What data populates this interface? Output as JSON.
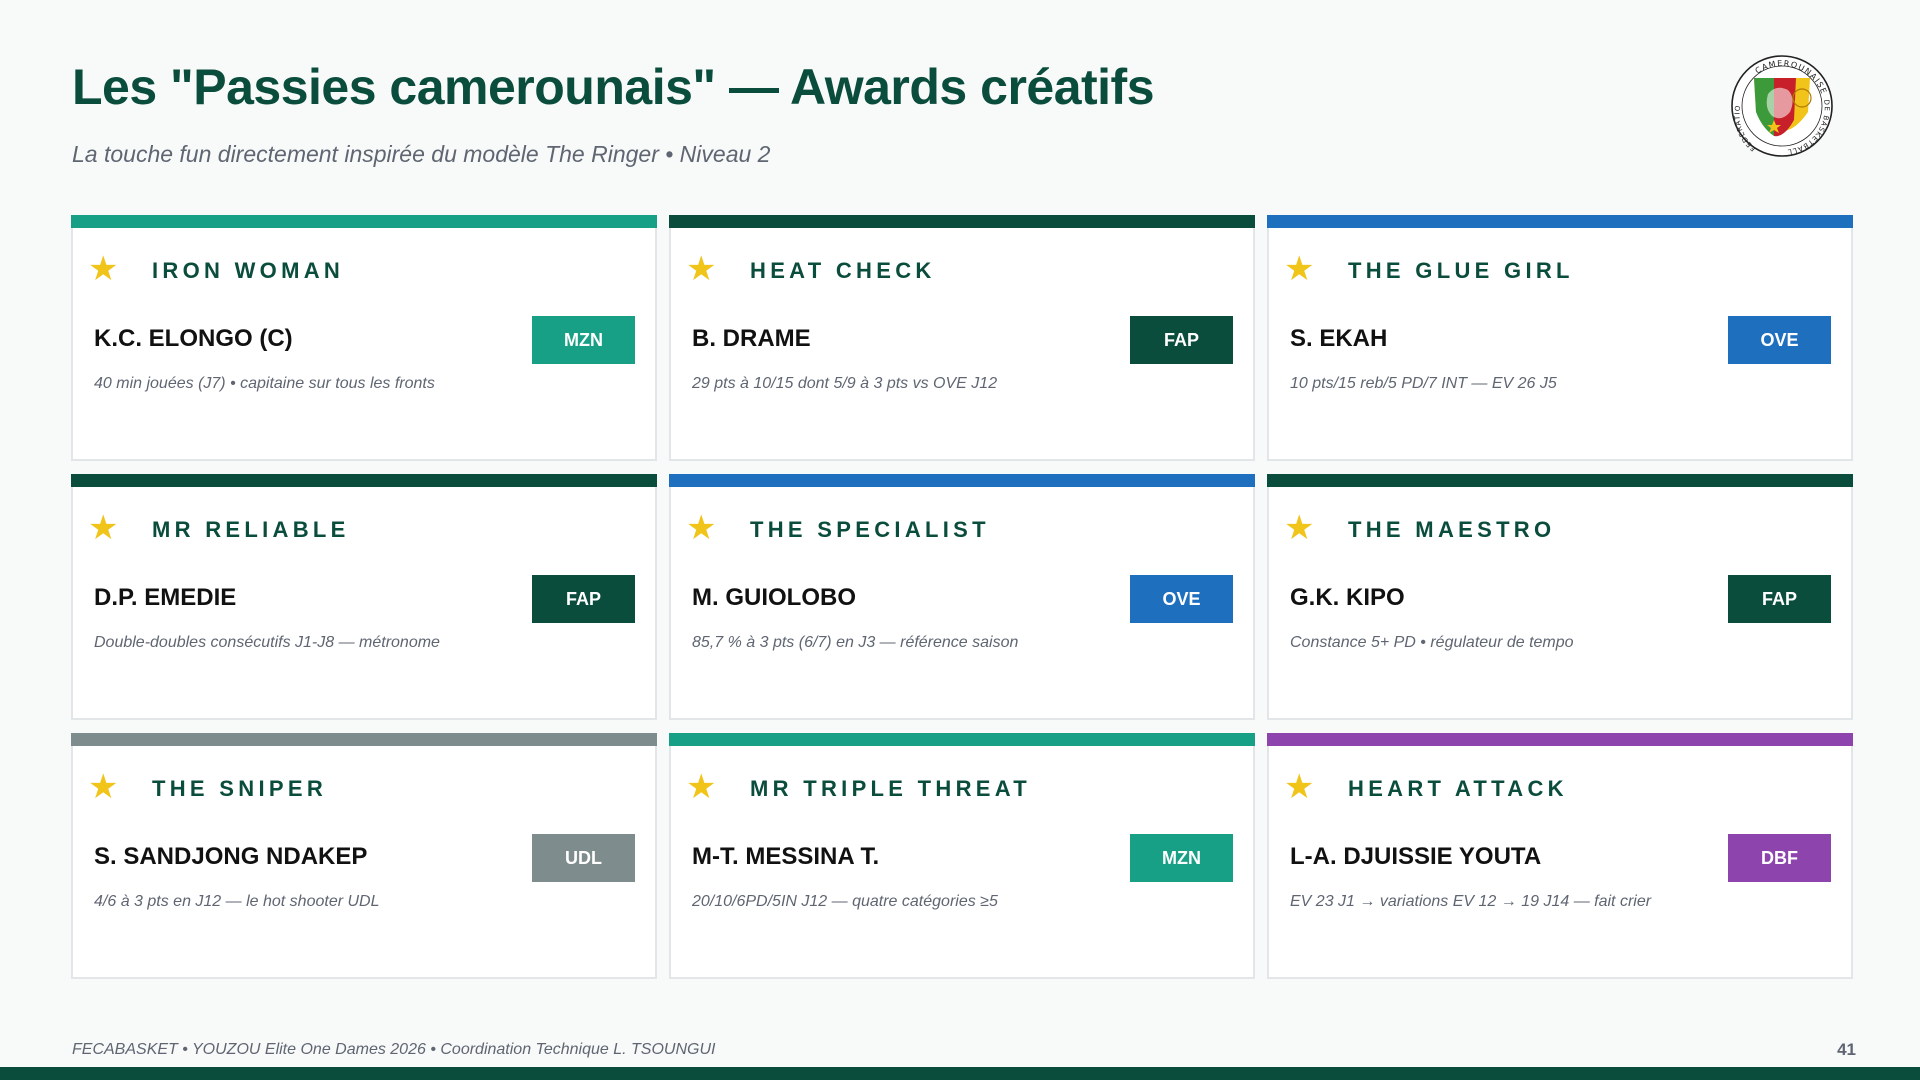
{
  "header": {
    "title": "Les \"Passies camerounais\" — Awards créatifs",
    "subtitle": "La touche fun directement inspirée du modèle The Ringer • Niveau 2"
  },
  "logo": {
    "ring_text_top": "CAMEROUNAISE",
    "ring_text_left": "FEDERATION",
    "ring_text_right": "DE BASKETBALL",
    "colors": {
      "green": "#3d9a3a",
      "red": "#c8202a",
      "yellow": "#f2c318"
    }
  },
  "awards": [
    {
      "award": "IRON WOMAN",
      "player": "K.C. ELONGO (C)",
      "team": "MZN",
      "stat": "40 min jouées (J7) • capitaine sur tous les fronts",
      "color": "#17a085"
    },
    {
      "award": "HEAT CHECK",
      "player": "B. DRAME",
      "team": "FAP",
      "stat": "29 pts à 10/15 dont 5/9 à 3 pts vs OVE J12",
      "color": "#0b4d3c"
    },
    {
      "award": "THE GLUE GIRL",
      "player": "S. EKAH",
      "team": "OVE",
      "stat": "10 pts/15 reb/5 PD/7 INT — EV 26 J5",
      "color": "#1f6fbf"
    },
    {
      "award": "MR RELIABLE",
      "player": "D.P. EMEDIE",
      "team": "FAP",
      "stat": "Double-doubles consécutifs J1-J8 — métronome",
      "color": "#0b4d3c"
    },
    {
      "award": "THE SPECIALIST",
      "player": "M. GUIOLOBO",
      "team": "OVE",
      "stat": "85,7 % à 3 pts (6/7) en J3 — référence saison",
      "color": "#1f6fbf"
    },
    {
      "award": "THE MAESTRO",
      "player": "G.K. KIPO",
      "team": "FAP",
      "stat": "Constance 5+ PD • régulateur de tempo",
      "color": "#0b4d3c"
    },
    {
      "award": "THE SNIPER",
      "player": "S. SANDJONG NDAKEP",
      "team": "UDL",
      "stat": "4/6 à 3 pts en J12 — le hot shooter UDL",
      "color": "#7f8c8d"
    },
    {
      "award": "MR TRIPLE THREAT",
      "player": "M-T. MESSINA T.",
      "team": "MZN",
      "stat": "20/10/6PD/5IN J12 — quatre catégories ≥5",
      "color": "#17a085"
    },
    {
      "award": "HEART ATTACK",
      "player": "L-A. DJUISSIE YOUTA",
      "team": "DBF",
      "stat": "EV 23 J1 → variations EV 12 → 19 J14 — fait crier",
      "color": "#8e44ad"
    }
  ],
  "icons": {
    "award_icon": "star-icon",
    "star_glyph": "★"
  },
  "footer": {
    "text": "FECABASKET  •  YOUZOU Elite One Dames 2026  •  Coordination Technique L. TSOUNGUI",
    "page": "41"
  }
}
